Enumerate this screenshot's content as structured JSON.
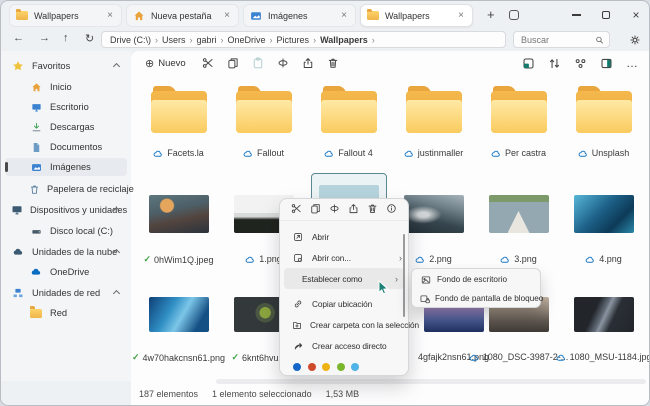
{
  "icons": {
    "close": "×",
    "plus": "+",
    "more": "…",
    "new": "⊕",
    "back": "←",
    "forward": "→",
    "up": "↑",
    "refresh": "↻",
    "chevron_right": "›",
    "check": "✓"
  },
  "window": {
    "tabs": [
      {
        "label": "Wallpapers",
        "icon": "folder"
      },
      {
        "label": "Nueva pestaña",
        "icon": "home"
      },
      {
        "label": "Imágenes",
        "icon": "picture"
      },
      {
        "label": "Wallpapers",
        "icon": "folder"
      }
    ]
  },
  "navbar": {
    "breadcrumb": [
      "Drive (C:\\)",
      "Users",
      "gabri",
      "OneDrive",
      "Pictures",
      "Wallpapers"
    ],
    "search_placeholder": "Buscar"
  },
  "toolbar": {
    "new_label": "Nuevo"
  },
  "sidebar": {
    "favorites_label": "Favoritos",
    "favorites": [
      "Inicio",
      "Escritorio",
      "Descargas",
      "Documentos",
      "Imágenes",
      "Papelera de reciclaje"
    ],
    "devices_label": "Dispositivos y unidades",
    "devices": [
      "Disco local (C:)"
    ],
    "cloud_label": "Unidades de la nube",
    "cloud": [
      "OneDrive"
    ],
    "network_label": "Unidades de red",
    "network": [
      "Red"
    ]
  },
  "grid": {
    "folders": [
      "Facets.la",
      "Fallout",
      "Fallout 4",
      "justinmaller",
      "Per castra",
      "Unsplash"
    ],
    "row2": [
      {
        "name": "0hWim1Q.jpeg",
        "badge": "check"
      },
      {
        "name": "1.png",
        "badge": "cloud"
      },
      {
        "name": "",
        "badge": "",
        "selected": true
      },
      {
        "name": "2.png",
        "badge": "cloud"
      },
      {
        "name": "3.png",
        "badge": "cloud"
      },
      {
        "name": "4.png",
        "badge": "cloud"
      }
    ],
    "row3": [
      {
        "name": "4w70hakcnsn61.png",
        "badge": "check"
      },
      {
        "name": "6knt6hvuz7t6",
        "badge": "check"
      },
      {
        "name": "",
        "badge": ""
      },
      {
        "name": "4gfajk2nsn61.png",
        "badge": ""
      },
      {
        "name": "1080_DSC-3987-2-...",
        "badge": "cloud"
      },
      {
        "name": "1080_MSU-1184.jpg",
        "badge": "cloud"
      }
    ]
  },
  "context_menu": {
    "open": "Abrir",
    "open_with": "Abrir con...",
    "set_as": "Establecer como",
    "copy_location": "Copiar ubicación",
    "create_folder_selection": "Crear carpeta con la selección",
    "create_shortcut": "Crear acceso directo",
    "tag_colors": [
      "#1467c6",
      "#cf4a2c",
      "#eeb211",
      "#7ab62c",
      "#4fb3e8"
    ]
  },
  "submenu": {
    "desktop": "Fondo de escritorio",
    "lockscreen": "Fondo de pantalla de bloqueo"
  },
  "statusbar": {
    "count": "187 elementos",
    "selected": "1 elemento seleccionado",
    "size": "1,53 MB"
  }
}
